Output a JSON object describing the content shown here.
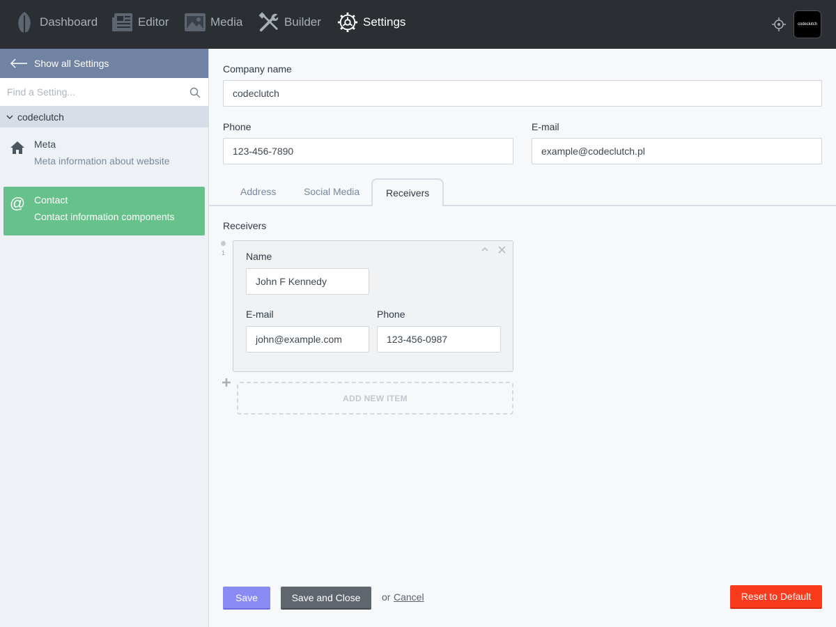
{
  "topnav": {
    "items": [
      {
        "label": "Dashboard",
        "icon": "leaf-icon"
      },
      {
        "label": "Editor",
        "icon": "newspaper-icon"
      },
      {
        "label": "Media",
        "icon": "image-icon"
      },
      {
        "label": "Builder",
        "icon": "tools-icon"
      },
      {
        "label": "Settings",
        "icon": "gear-icon",
        "active": true
      }
    ],
    "avatar_text": "codeclutch"
  },
  "sidebar": {
    "show_all_label": "Show all Settings",
    "search_placeholder": "Find a Setting...",
    "group_label": "codeclutch",
    "items": [
      {
        "title": "Meta",
        "description": "Meta information about website",
        "icon": "home-icon"
      },
      {
        "title": "Contact",
        "description": "Contact information components",
        "icon": "at-icon",
        "active": true
      }
    ]
  },
  "form": {
    "company_name_label": "Company name",
    "company_name_value": "codeclutch",
    "phone_label": "Phone",
    "phone_value": "123-456-7890",
    "email_label": "E-mail",
    "email_value": "example@codeclutch.pl"
  },
  "tabs": [
    {
      "label": "Address"
    },
    {
      "label": "Social Media"
    },
    {
      "label": "Receivers",
      "active": true
    }
  ],
  "receivers": {
    "section_label": "Receivers",
    "items": [
      {
        "index": "1",
        "name_label": "Name",
        "name_value": "John F Kennedy",
        "email_label": "E-mail",
        "email_value": "john@example.com",
        "phone_label": "Phone",
        "phone_value": "123-456-0987"
      }
    ],
    "add_item_label": "ADD NEW ITEM"
  },
  "actions": {
    "save_label": "Save",
    "save_close_label": "Save and Close",
    "or_text": "or",
    "cancel_label": "Cancel",
    "reset_label": "Reset to Default"
  },
  "colors": {
    "topbar": "#2b2f33",
    "sidebar_header": "#7183a3",
    "active_item": "#67c18a",
    "save": "#8a8bf2",
    "save_close": "#5f666e",
    "reset": "#fa3c1e"
  }
}
